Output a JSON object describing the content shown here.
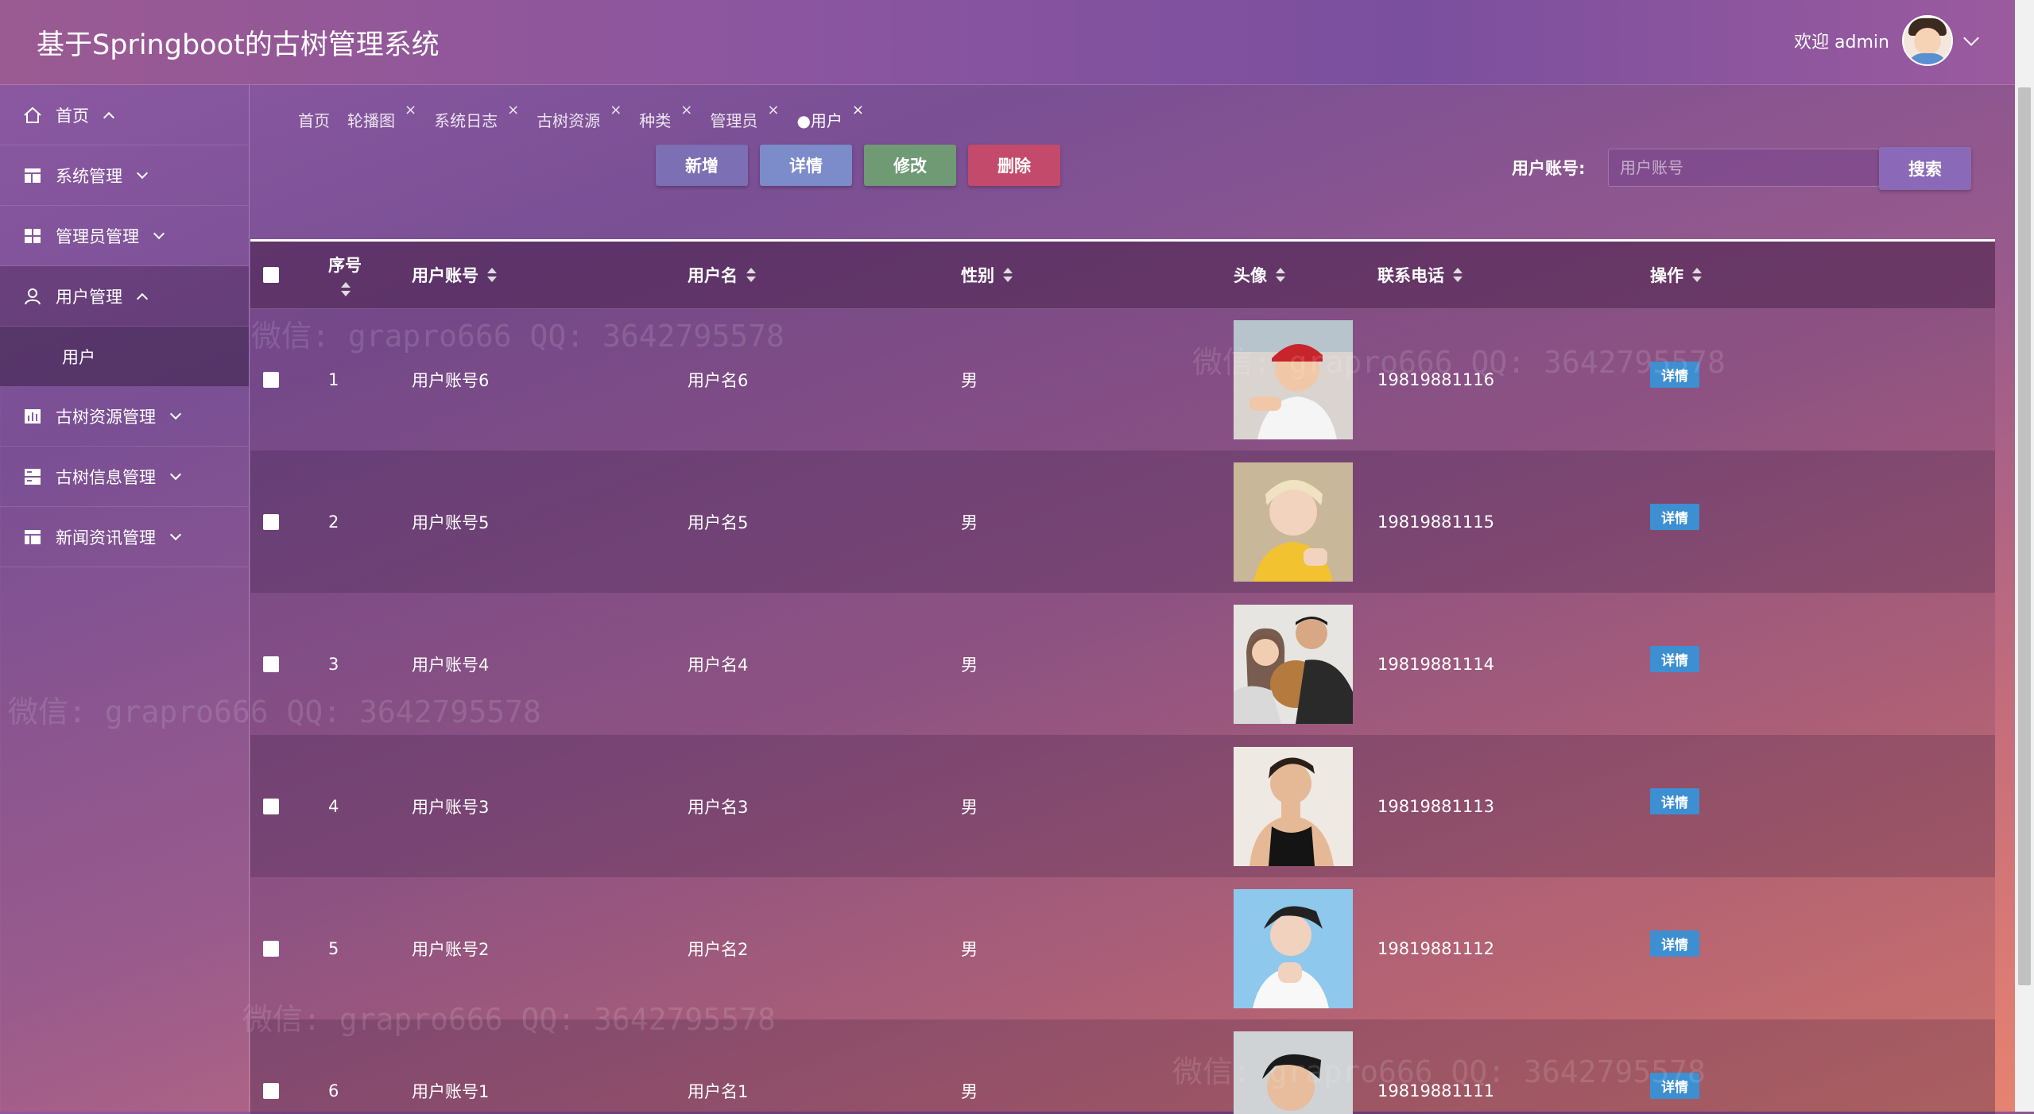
{
  "header": {
    "title": "基于Springboot的古树管理系统",
    "welcome": "欢迎 admin"
  },
  "sidebar": {
    "items": [
      {
        "label": "首页",
        "icon": "home-icon"
      },
      {
        "label": "系统管理",
        "icon": "table-icon"
      },
      {
        "label": "管理员管理",
        "icon": "grid-icon"
      },
      {
        "label": "用户管理",
        "icon": "user-icon"
      },
      {
        "label": "古树资源管理",
        "icon": "chart-icon"
      },
      {
        "label": "古树信息管理",
        "icon": "server-icon"
      },
      {
        "label": "新闻资讯管理",
        "icon": "layout-icon"
      }
    ],
    "sub_item": "用户"
  },
  "tabs": [
    {
      "label": "首页"
    },
    {
      "label": "轮播图"
    },
    {
      "label": "系统日志"
    },
    {
      "label": "古树资源"
    },
    {
      "label": "种类"
    },
    {
      "label": "管理员"
    },
    {
      "label": "●用户"
    }
  ],
  "tab_close": "×",
  "toolbar": {
    "add": "新增",
    "detail": "详情",
    "edit": "修改",
    "delete": "删除",
    "search_label": "用户账号:",
    "search_placeholder": "用户账号",
    "search_button": "搜索",
    "colors": {
      "add": "#7c6fb3",
      "detail": "#7c8bc9",
      "edit": "#6f9a74",
      "delete": "#c44a6b"
    }
  },
  "table": {
    "headers": {
      "index": "序号",
      "account": "用户账号",
      "name": "用户名",
      "gender": "性别",
      "avatar": "头像",
      "phone": "联系电话",
      "action": "操作"
    },
    "rows": [
      {
        "index": "1",
        "account": "用户账号6",
        "name": "用户名6",
        "gender": "男",
        "phone": "19819881116",
        "action": "详情"
      },
      {
        "index": "2",
        "account": "用户账号5",
        "name": "用户名5",
        "gender": "男",
        "phone": "19819881115",
        "action": "详情"
      },
      {
        "index": "3",
        "account": "用户账号4",
        "name": "用户名4",
        "gender": "男",
        "phone": "19819881114",
        "action": "详情"
      },
      {
        "index": "4",
        "account": "用户账号3",
        "name": "用户名3",
        "gender": "男",
        "phone": "19819881113",
        "action": "详情"
      },
      {
        "index": "5",
        "account": "用户账号2",
        "name": "用户名2",
        "gender": "男",
        "phone": "19819881112",
        "action": "详情"
      },
      {
        "index": "6",
        "account": "用户账号1",
        "name": "用户名1",
        "gender": "男",
        "phone": "19819881111",
        "action": "详情"
      }
    ]
  },
  "watermarks": [
    "微信: grapro666 QQ: 3642795578",
    "微信: grapro666 QQ: 3642795578",
    "微信: grapro666 QQ: 3642795578",
    "微信: grapro666 QQ: 3642795578",
    "微信: grapro666 QQ: 3642795578"
  ]
}
